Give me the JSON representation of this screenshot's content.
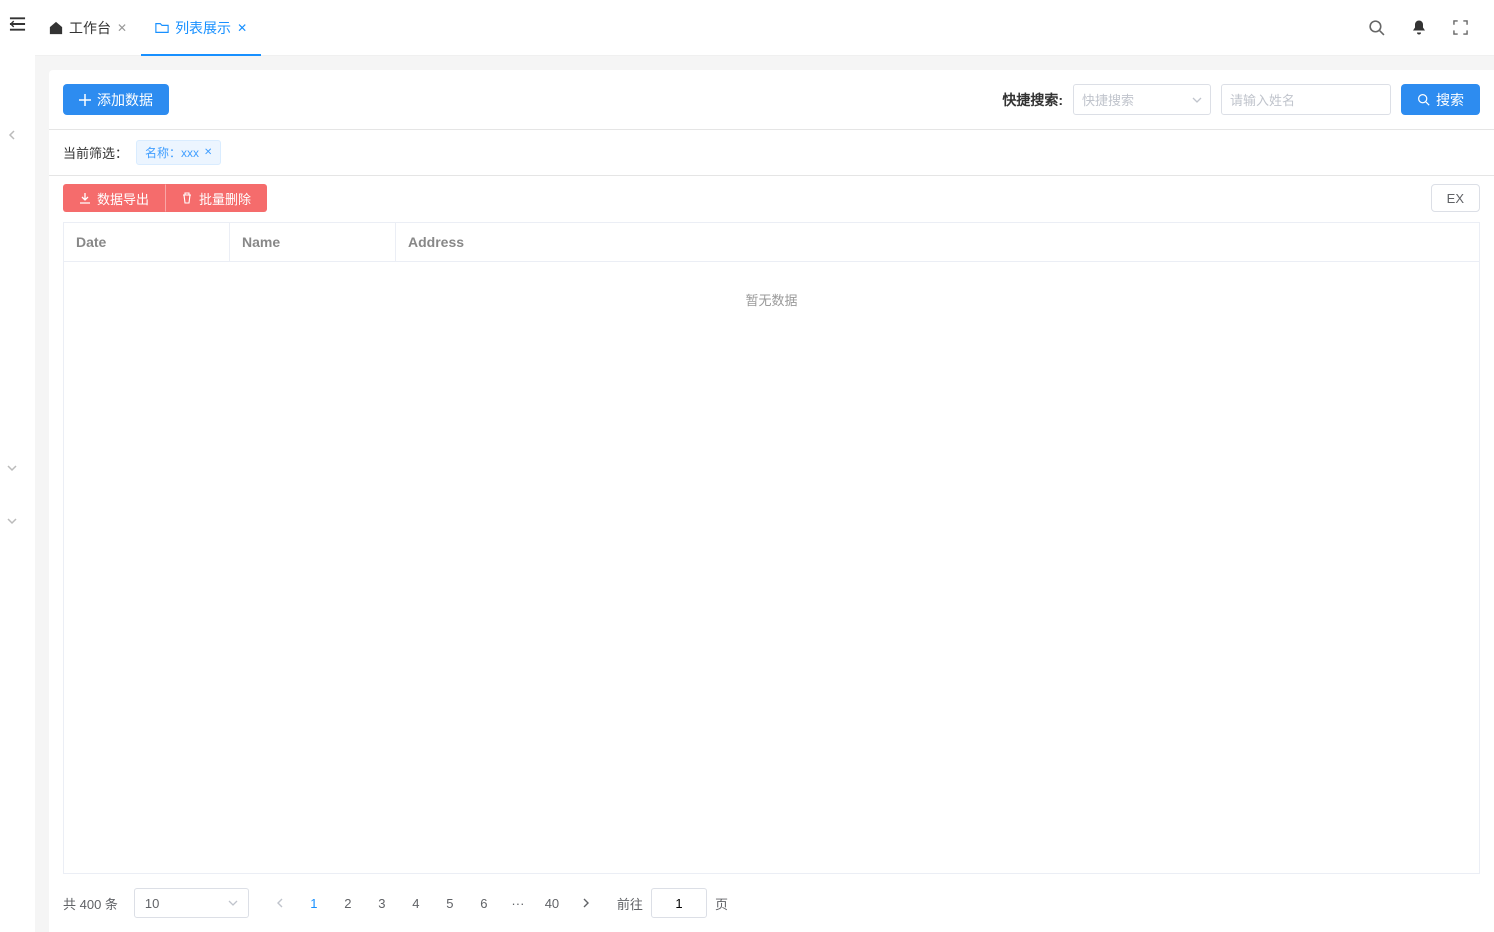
{
  "tabs": [
    {
      "label": "工作台",
      "icon": "home",
      "active": false
    },
    {
      "label": "列表展示",
      "icon": "folder",
      "active": true
    }
  ],
  "toolbar": {
    "add_button": "添加数据",
    "quick_search_label": "快捷搜索:",
    "quick_search_placeholder": "快捷搜索",
    "name_placeholder": "请输入姓名",
    "search_button": "搜索"
  },
  "filter": {
    "label": "当前筛选：",
    "tags": [
      {
        "text": "名称：xxx"
      }
    ]
  },
  "actions": {
    "export_button": "数据导出",
    "batch_delete_button": "批量删除",
    "right_button": "EX"
  },
  "table": {
    "columns": [
      "Date",
      "Name",
      "Address"
    ],
    "empty_text": "暂无数据"
  },
  "pagination": {
    "total_text": "共 400 条",
    "page_size": "10",
    "pages": [
      "1",
      "2",
      "3",
      "4",
      "5",
      "6"
    ],
    "ellipsis": "···",
    "last_page": "40",
    "current": 1,
    "jump_prefix": "前往",
    "jump_value": "1",
    "jump_suffix": "页"
  }
}
